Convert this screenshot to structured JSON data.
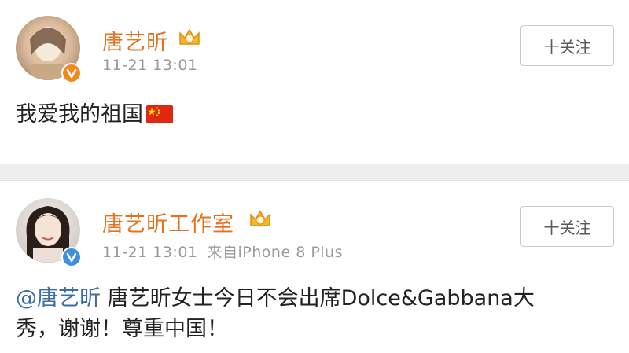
{
  "posts": [
    {
      "author": "唐艺昕",
      "time": "11-21 13:01",
      "source": "",
      "follow_label": "十关注",
      "text": "我爱我的祖国",
      "emoji": "china-flag-icon"
    },
    {
      "author": "唐艺昕工作室",
      "time": "11-21 13:01",
      "source": "来自iPhone 8 Plus",
      "follow_label": "十关注",
      "mention": "@唐艺昕",
      "text_line1": " 唐艺昕女士今日不会出席Dolce&Gabbana大",
      "text_line2": "秀，谢谢！尊重中国！"
    }
  ],
  "colors": {
    "name": "#e5721f",
    "mention": "#3b6ea8",
    "verified_orange": "#f08a1c",
    "verified_blue": "#3d8fe0",
    "divider": "#eeeeee"
  }
}
